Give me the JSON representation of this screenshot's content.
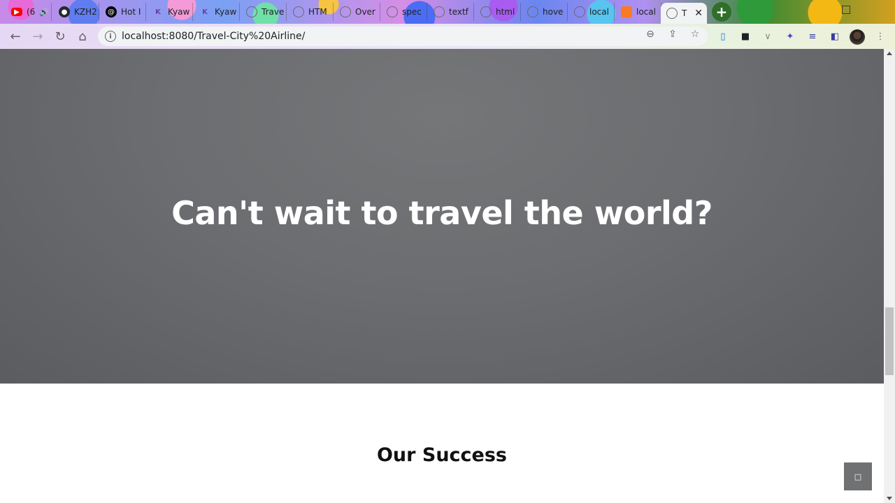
{
  "browser": {
    "tabs": [
      {
        "label": "(6",
        "icon": "youtube-icon",
        "color": "#ff0000"
      },
      {
        "label": "KZH2",
        "icon": "github-icon",
        "color": "#24292e"
      },
      {
        "label": "Hot I",
        "icon": "threads-icon",
        "color": "#000000"
      },
      {
        "label": "Kyaw",
        "icon": "k-logo-icon",
        "color": "#6b3fa0"
      },
      {
        "label": "Kyaw",
        "icon": "k-logo-icon",
        "color": "#6b3fa0"
      },
      {
        "label": "Trave",
        "icon": "globe-icon",
        "color": "#6a6a6a"
      },
      {
        "label": "HTM",
        "icon": "globe-icon",
        "color": "#6a6a6a"
      },
      {
        "label": "Over",
        "icon": "globe-icon",
        "color": "#6a6a6a"
      },
      {
        "label": "spec",
        "icon": "globe-icon",
        "color": "#6a6a6a"
      },
      {
        "label": "textf",
        "icon": "globe-icon",
        "color": "#6a6a6a"
      },
      {
        "label": "html",
        "icon": "globe-icon",
        "color": "#6a6a6a"
      },
      {
        "label": "hove",
        "icon": "globe-icon",
        "color": "#6a6a6a"
      },
      {
        "label": "local",
        "icon": "globe-icon",
        "color": "#6a6a6a"
      },
      {
        "label": "local",
        "icon": "xampp-icon",
        "color": "#fb7a24"
      },
      {
        "label": "T",
        "icon": "globe-icon",
        "color": "#6a6a6a",
        "active": true
      }
    ],
    "address": "localhost:8080/Travel-City%20Airline/"
  },
  "page": {
    "hero_heading": "Can't wait to travel the world?",
    "section_title": "Our Success",
    "back_to_top_glyph": "□"
  },
  "colors": {
    "hero_overlay": "#6c6d70",
    "back_to_top_bg": "#707173"
  }
}
